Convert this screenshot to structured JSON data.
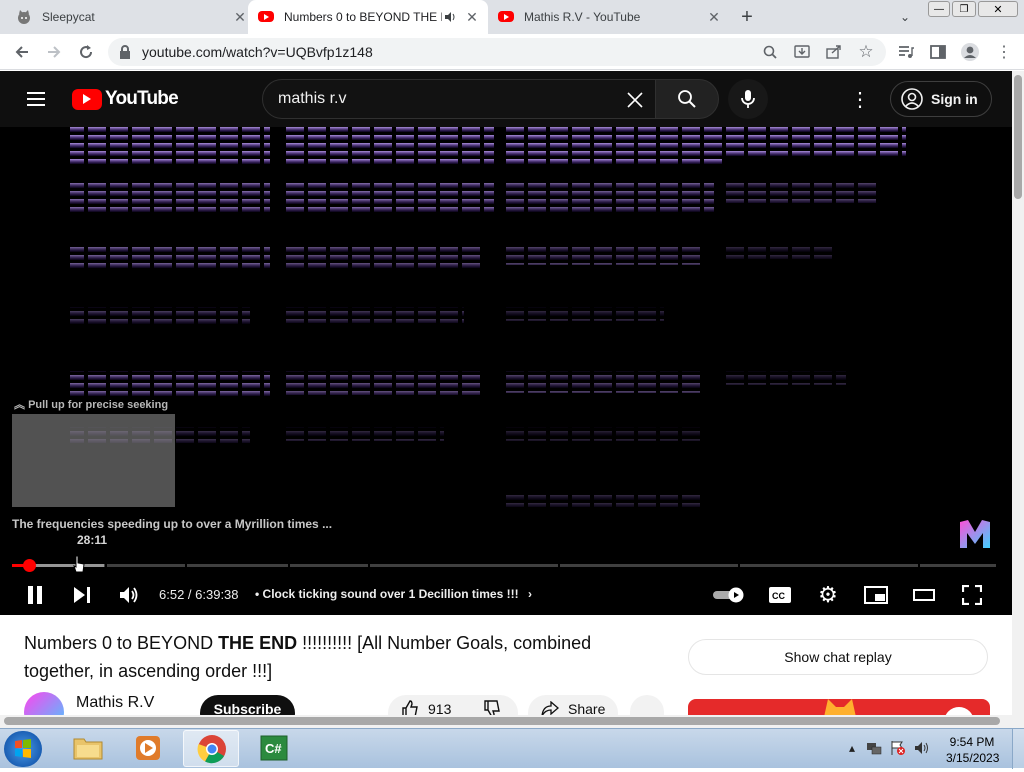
{
  "tabs": [
    {
      "title": "Sleepycat",
      "favicon": "cat-icon",
      "active": false
    },
    {
      "title": "Numbers 0 to BEYOND THE END !!!!!!!!!! [All Number Goals",
      "favicon": "youtube-icon",
      "active": true,
      "audio": true
    },
    {
      "title": "Mathis R.V - YouTube",
      "favicon": "youtube-icon",
      "active": false
    }
  ],
  "address": {
    "url": "youtube.com/watch?v=UQBvfp1z148"
  },
  "yt": {
    "logo_text": "YouTube",
    "search_value": "mathis r.v",
    "signin_label": "Sign in"
  },
  "player": {
    "seek_hint": "Pull up for precise seeking",
    "preview_chapter": "The frequencies speeding up to over a Myrillion times ...",
    "preview_time": "28:11",
    "time_display": "6:52 / 6:39:38",
    "chapter_label": "• Clock ticking sound over 1 Decillion times !!!",
    "progress_played": 0.017,
    "progress_loaded": 0.094
  },
  "video": {
    "title_part1": "Numbers 0 to BEYOND ",
    "title_bold": "THE END",
    "title_part2": " !!!!!!!!!! [All Number Goals, combined together, in ascending order !!!]",
    "chat_button": "Show chat replay",
    "channel_name": "Mathis R.V",
    "subscribe_label": "Subscribe",
    "likes": "913",
    "share_label": "Share"
  },
  "taskbar": {
    "time": "9:54 PM",
    "date": "3/15/2023"
  },
  "colors": {
    "accent": "#ff0000",
    "yt_bg": "#0f0f0f",
    "taskbar": "#b8cce4"
  }
}
